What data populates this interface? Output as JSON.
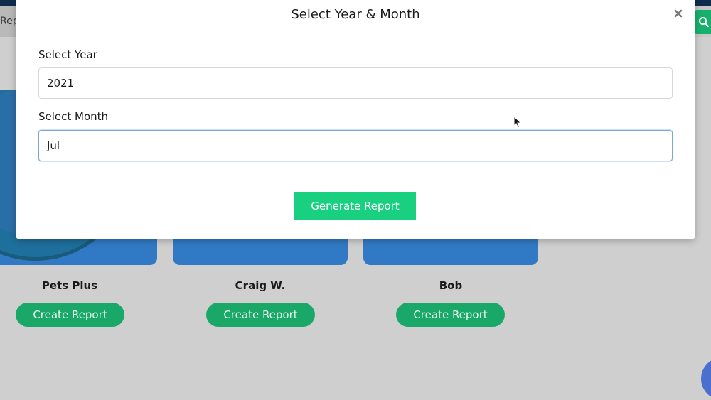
{
  "background": {
    "tab_label": "Rep",
    "search_icon": "search-icon",
    "cards": [
      {
        "name": "Pets Plus",
        "button_label": "Create Report"
      },
      {
        "name": "Craig W.",
        "button_label": "Create Report"
      },
      {
        "name": "Bob",
        "button_label": "Create Report"
      }
    ]
  },
  "modal": {
    "title": "Select Year & Month",
    "close_icon": "close-icon",
    "year_label": "Select Year",
    "year_value": "2021",
    "month_label": "Select Month",
    "month_value": "Jul",
    "generate_label": "Generate Report"
  },
  "colors": {
    "accent_green": "#19d081",
    "button_green": "#1aa869",
    "card_blue": "#3179c4",
    "nav_dark": "#0f2c4c"
  }
}
